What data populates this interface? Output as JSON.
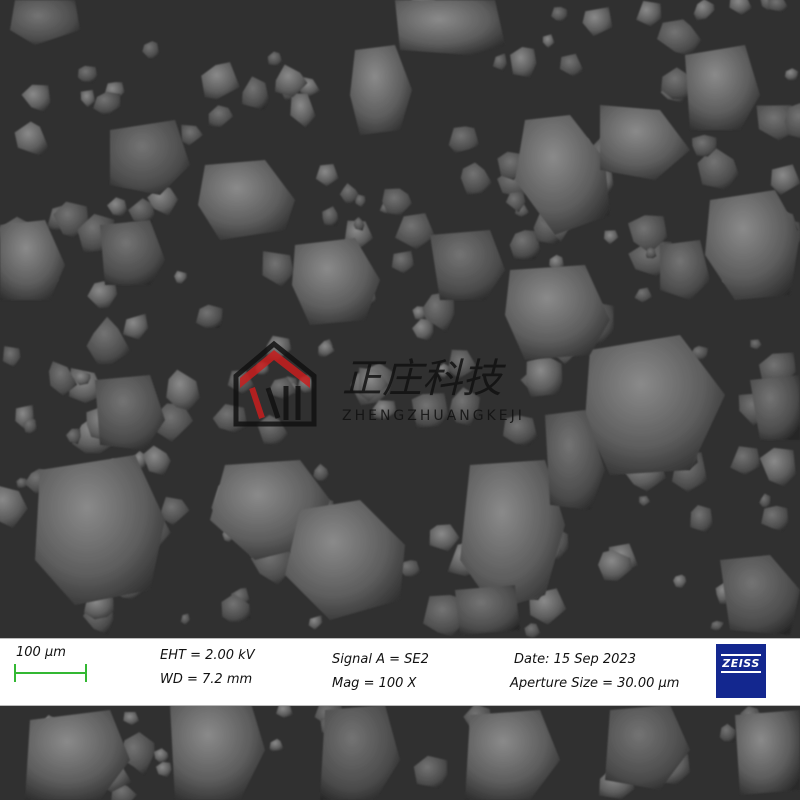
{
  "image": {
    "description_icon": "sem-micrograph-particles"
  },
  "watermark": {
    "logo_icon": "zhengzhuang-logo-icon",
    "cn_text": "正庄科技",
    "en_text": "ZHENGZHUANGKEJI"
  },
  "info_bar": {
    "scale_label": "100 µm",
    "eht": "EHT =  2.00 kV",
    "wd": "WD =  7.2 mm",
    "signal": "Signal A = SE2",
    "mag": "Mag =     100 X",
    "date": "Date: 15 Sep 2023",
    "aperture": "Aperture Size = 30.00 µm",
    "logo_word": "ZEISS",
    "logo_icon": "zeiss-logo-icon",
    "scalebar_color": "#33b833"
  }
}
